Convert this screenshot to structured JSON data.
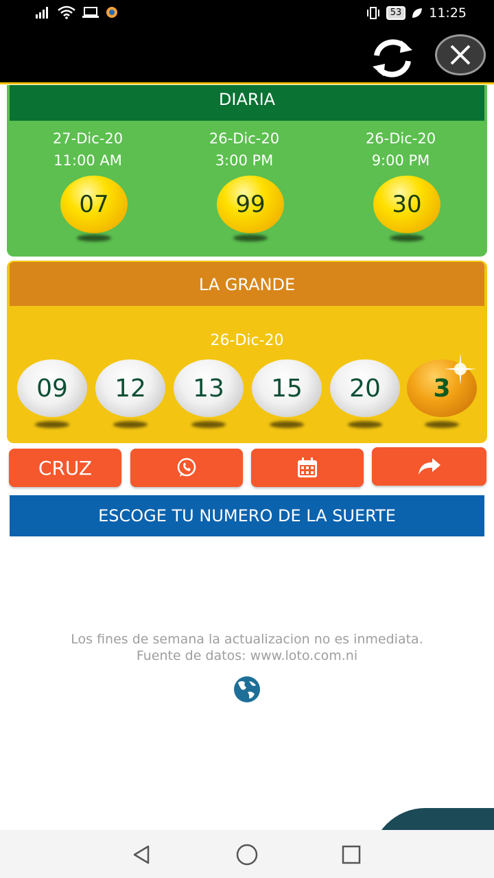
{
  "status_bar": {
    "time": "11:25",
    "battery": "53"
  },
  "diaria": {
    "title": "DIARIA",
    "draws": [
      {
        "date": "27-Dic-20",
        "time": "11:00 AM",
        "number": "07"
      },
      {
        "date": "26-Dic-20",
        "time": "3:00 PM",
        "number": "99"
      },
      {
        "date": "26-Dic-20",
        "time": "9:00 PM",
        "number": "30"
      }
    ]
  },
  "la_grande": {
    "title": "LA GRANDE",
    "date": "26-Dic-20",
    "numbers": [
      "09",
      "12",
      "13",
      "15",
      "20"
    ],
    "bonus": "3"
  },
  "actions": {
    "cruz_label": "CRUZ"
  },
  "lucky_button": "ESCOGE TU NUMERO DE LA SUERTE",
  "info": {
    "line1": "Los fines de semana la actualizacion no es inmediata.",
    "line2": "Fuente de datos: www.loto.com.ni"
  },
  "colors": {
    "diaria_bg": "#5cbf4f",
    "diaria_header": "#0a7232",
    "grande_bg": "#f3c512",
    "grande_header": "#d8861a",
    "action_button": "#f5582c",
    "lucky_button": "#0b62ad"
  },
  "icons": [
    "wifi-icon",
    "signal-icon",
    "refresh-icon",
    "close-icon",
    "whatsapp-icon",
    "calendar-icon",
    "share-icon",
    "globe-icon"
  ]
}
